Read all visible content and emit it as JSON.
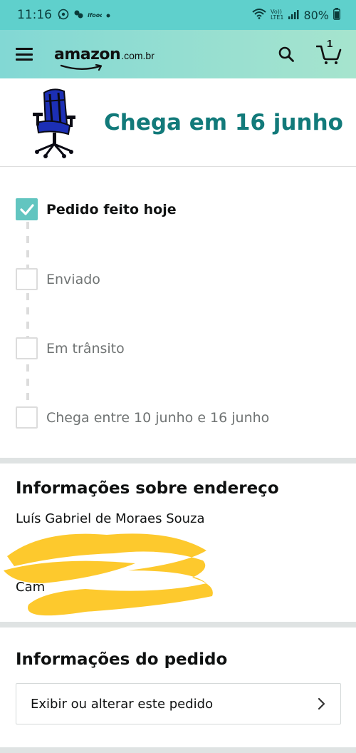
{
  "status_bar": {
    "time": "11:16",
    "battery": "80%",
    "network": "LTE1",
    "volte": "Vo))"
  },
  "header": {
    "logo_text": "amazon",
    "logo_tld": ".com.br",
    "cart_count": "1",
    "colors": {
      "gradient_start": "#82d8d4",
      "gradient_end": "#a6e4ce"
    }
  },
  "delivery": {
    "title": "Chega em 16 junho",
    "product_image": "gaming-chair-blue-black",
    "title_color": "#127a7a"
  },
  "tracker": {
    "steps": [
      {
        "label": "Pedido feito hoje",
        "done": true
      },
      {
        "label": "Enviado",
        "done": false
      },
      {
        "label": "Em trânsito",
        "done": false
      },
      {
        "label": "Chega entre 10 junho e 16 junho",
        "done": false
      }
    ],
    "check_color": "#62c5c0"
  },
  "address": {
    "title": "Informações sobre endereço",
    "name": "Luís Gabriel de Moraes Souza",
    "partial_line": "Cam",
    "redaction_color": "#fdc92d"
  },
  "order": {
    "title": "Informações do pedido",
    "link_label": "Exibir ou alterar este pedido"
  }
}
